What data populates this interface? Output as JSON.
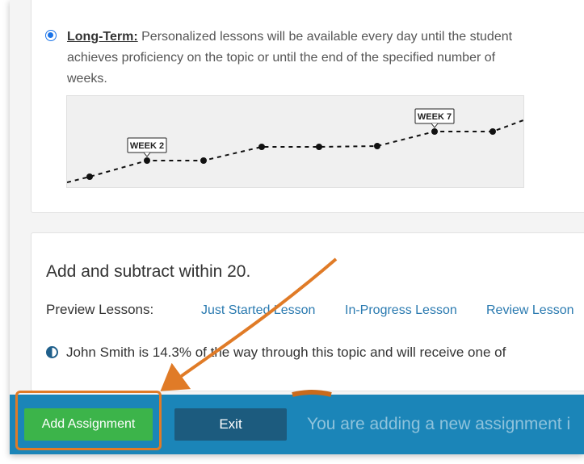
{
  "long_term": {
    "label": "Long-Term:",
    "description": " Personalized lessons will be available every day until the student achieves proficiency on the topic or until the end of the specified number of weeks.",
    "selected": true
  },
  "timeline": {
    "markers": [
      {
        "label": "WEEK 2",
        "point_index": 1
      },
      {
        "label": "WEEK 7",
        "point_index": 6
      }
    ]
  },
  "topic": {
    "title": "Add and subtract within 20.",
    "preview_label": "Preview Lessons:",
    "lessons": [
      "Just Started Lesson",
      "In-Progress Lesson",
      "Review Lesson"
    ],
    "progress_text": "John Smith is 14.3% of the way through this topic and will receive one of"
  },
  "bottom_bar": {
    "add_button": "Add Assignment",
    "exit_button": "Exit",
    "message": "You are adding a new assignment i"
  },
  "colors": {
    "accent_green": "#3cb44a",
    "bar_blue": "#1b85b8",
    "exit_blue": "#1c5b7e",
    "highlight_orange": "#e07b27"
  }
}
